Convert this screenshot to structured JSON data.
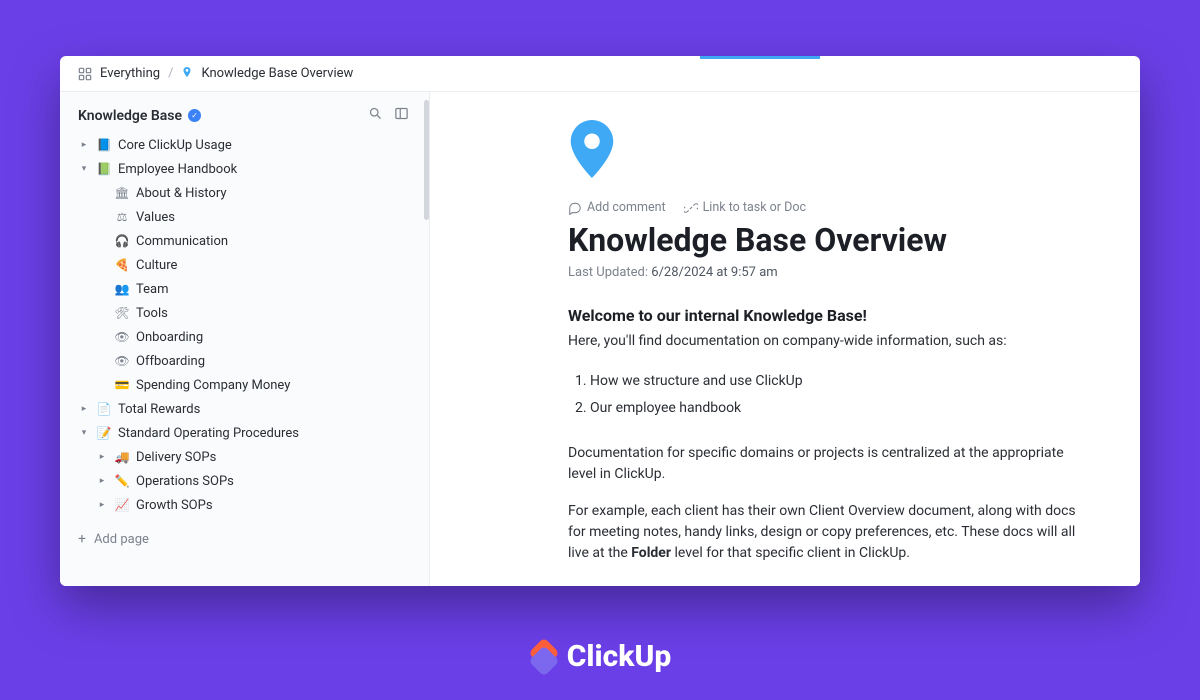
{
  "breadcrumb": {
    "root": "Everything",
    "current": "Knowledge Base Overview"
  },
  "sidebar": {
    "title": "Knowledge Base",
    "add_page": "Add page",
    "nodes": [
      {
        "level": 0,
        "chev": "right",
        "icon": "📘",
        "iconColor": "#7B68EE",
        "label": "Core ClickUp Usage"
      },
      {
        "level": 0,
        "chev": "down",
        "icon": "📗",
        "iconColor": "#4CAF50",
        "label": "Employee Handbook"
      },
      {
        "level": 1,
        "chev": "",
        "icon": "🏛",
        "iconColor": "#7C828D",
        "label": "About & History"
      },
      {
        "level": 1,
        "chev": "",
        "icon": "⚖",
        "iconColor": "#7C828D",
        "label": "Values"
      },
      {
        "level": 1,
        "chev": "",
        "icon": "🎧",
        "iconColor": "#7C828D",
        "label": "Communication"
      },
      {
        "level": 1,
        "chev": "",
        "icon": "🍕",
        "iconColor": "#7C828D",
        "label": "Culture"
      },
      {
        "level": 1,
        "chev": "",
        "icon": "👥",
        "iconColor": "#7C828D",
        "label": "Team"
      },
      {
        "level": 1,
        "chev": "",
        "icon": "🛠",
        "iconColor": "#7C828D",
        "label": "Tools"
      },
      {
        "level": 1,
        "chev": "",
        "icon": "👁",
        "iconColor": "#7C828D",
        "label": "Onboarding"
      },
      {
        "level": 1,
        "chev": "",
        "icon": "👁",
        "iconColor": "#7C828D",
        "label": "Offboarding"
      },
      {
        "level": 1,
        "chev": "",
        "icon": "💳",
        "iconColor": "#7C828D",
        "label": "Spending Company Money"
      },
      {
        "level": 0,
        "chev": "right",
        "icon": "📄",
        "iconColor": "#7C828D",
        "label": "Total Rewards"
      },
      {
        "level": 0,
        "chev": "down",
        "icon": "📝",
        "iconColor": "#7C828D",
        "label": "Standard Operating Procedures"
      },
      {
        "level": 1,
        "chev": "right",
        "icon": "🚚",
        "iconColor": "#7C828D",
        "label": "Delivery SOPs"
      },
      {
        "level": 1,
        "chev": "right",
        "icon": "✏️",
        "iconColor": "#7C828D",
        "label": "Operations SOPs"
      },
      {
        "level": 1,
        "chev": "right",
        "icon": "📈",
        "iconColor": "#7C828D",
        "label": "Growth SOPs"
      }
    ]
  },
  "doc": {
    "actions": {
      "add_comment": "Add comment",
      "link_task": "Link to task or Doc"
    },
    "title": "Knowledge Base Overview",
    "meta_label": "Last Updated:",
    "meta_value": "6/28/2024 at 9:57 am",
    "h3": "Welcome to our internal Knowledge Base!",
    "p1": "Here, you'll find documentation on company-wide information, such as:",
    "list": [
      "How we structure and use ClickUp",
      "Our employee handbook"
    ],
    "p2": "Documentation for specific domains or projects is centralized at the appropriate level in ClickUp.",
    "p3_a": "For example, each client has their own Client Overview document, along with docs for meeting notes, handy links, design or copy preferences, etc. These docs will all live at the ",
    "p3_bold": "Folder",
    "p3_b": " level for that specific client in ClickUp."
  },
  "brand": "ClickUp"
}
